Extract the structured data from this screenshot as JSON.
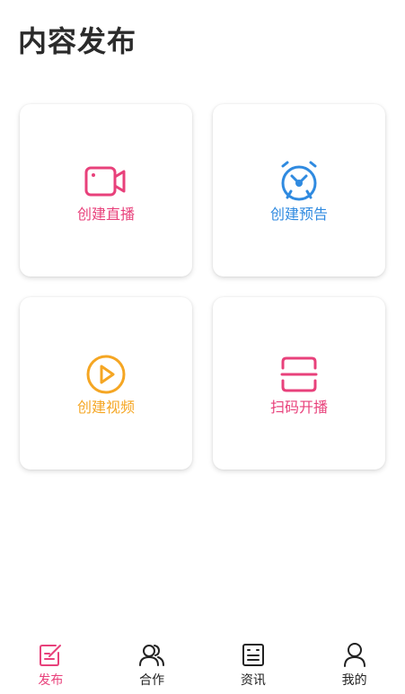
{
  "page": {
    "title": "内容发布"
  },
  "cards": [
    {
      "label": "创建直播",
      "icon": "video-camera-icon",
      "color": "#e8417b"
    },
    {
      "label": "创建预告",
      "icon": "alarm-clock-icon",
      "color": "#2f8ae0"
    },
    {
      "label": "创建视频",
      "icon": "play-circle-icon",
      "color": "#f5a623"
    },
    {
      "label": "扫码开播",
      "icon": "scan-icon",
      "color": "#e8417b"
    }
  ],
  "bottom_nav": {
    "active_index": 0,
    "active_color": "#e8417b",
    "items": [
      {
        "label": "发布",
        "icon": "edit-document-icon"
      },
      {
        "label": "合作",
        "icon": "users-icon"
      },
      {
        "label": "资讯",
        "icon": "news-icon"
      },
      {
        "label": "我的",
        "icon": "user-icon"
      }
    ]
  }
}
